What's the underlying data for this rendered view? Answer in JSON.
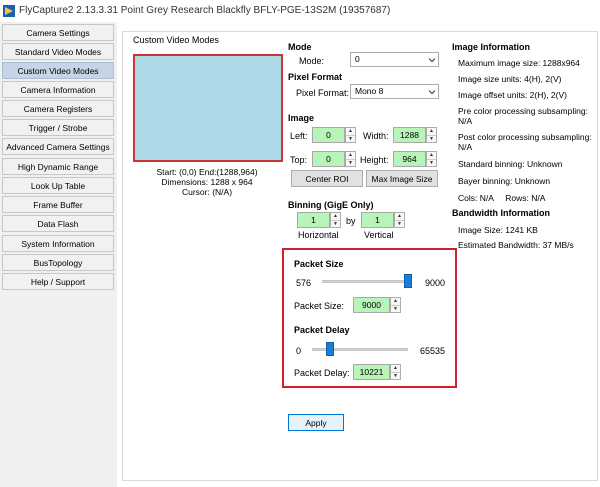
{
  "window": {
    "title": "FlyCapture2 2.13.3.31  Point Grey Research Blackfly BFLY-PGE-13S2M (19357687)"
  },
  "sidebar": {
    "items": [
      {
        "label": "Camera Settings"
      },
      {
        "label": "Standard Video Modes"
      },
      {
        "label": "Custom Video Modes",
        "active": true
      },
      {
        "label": "Camera Information"
      },
      {
        "label": "Camera Registers"
      },
      {
        "label": "Trigger / Strobe"
      },
      {
        "label": "Advanced Camera Settings"
      },
      {
        "label": "High Dynamic Range"
      },
      {
        "label": "Look Up Table"
      },
      {
        "label": "Frame Buffer"
      },
      {
        "label": "Data Flash"
      },
      {
        "label": "System Information"
      },
      {
        "label": "BusTopology"
      },
      {
        "label": "Help / Support"
      }
    ]
  },
  "panel": {
    "group_title": "Custom Video Modes",
    "preview": {
      "start_end": "Start: (0,0) End:(1288,964)",
      "dimensions": "Dimensions: 1288 x 964",
      "cursor": "Cursor: (N/A)"
    },
    "mode": {
      "heading": "Mode",
      "label": "Mode:",
      "value": "0"
    },
    "pixel_format": {
      "heading": "Pixel Format",
      "label": "Pixel Format:",
      "value": "Mono 8"
    },
    "image": {
      "heading": "Image",
      "left_label": "Left:",
      "left_value": "0",
      "width_label": "Width:",
      "width_value": "1288",
      "top_label": "Top:",
      "top_value": "0",
      "height_label": "Height:",
      "height_value": "964",
      "center_roi": "Center ROI",
      "max_image_size": "Max Image Size"
    },
    "binning": {
      "heading": "Binning (GigE Only)",
      "horizontal_value": "1",
      "by": "by",
      "vertical_value": "1",
      "horizontal_label": "Horizontal",
      "vertical_label": "Vertical"
    },
    "packet_size": {
      "heading": "Packet Size",
      "min": "576",
      "max": "9000",
      "slider_fraction": 1.0,
      "label": "Packet Size:",
      "value": "9000"
    },
    "packet_delay": {
      "heading": "Packet Delay",
      "min": "0",
      "max": "65535",
      "slider_fraction": 0.156,
      "label": "Packet Delay:",
      "value": "10221"
    },
    "apply_label": "Apply",
    "image_information": {
      "heading": "Image Information",
      "max_size": "Maximum image size: 1288x964",
      "size_units": "Image size units: 4(H), 2(V)",
      "offset_units": "Image offset units: 2(H), 2(V)",
      "pre_color": "Pre color processing subsampling: N/A",
      "post_color": "Post color processing subsampling: N/A",
      "standard_binning": "Standard binning: Unknown",
      "bayer_binning": "Bayer binning: Unknown",
      "cols_rows": "Cols: N/A     Rows: N/A"
    },
    "bandwidth_information": {
      "heading": "Bandwidth Information",
      "image_size": "Image Size: 1241 KB",
      "estimated_bandwidth": "Estimated Bandwidth: 37 MB/s"
    }
  },
  "colors": {
    "preview_fill": "#add8e6",
    "highlight_border": "#d0202a",
    "spin_fill": "#b8f3b8",
    "slider_thumb": "#1c7cd6",
    "active_nav": "#c7d4e6"
  }
}
